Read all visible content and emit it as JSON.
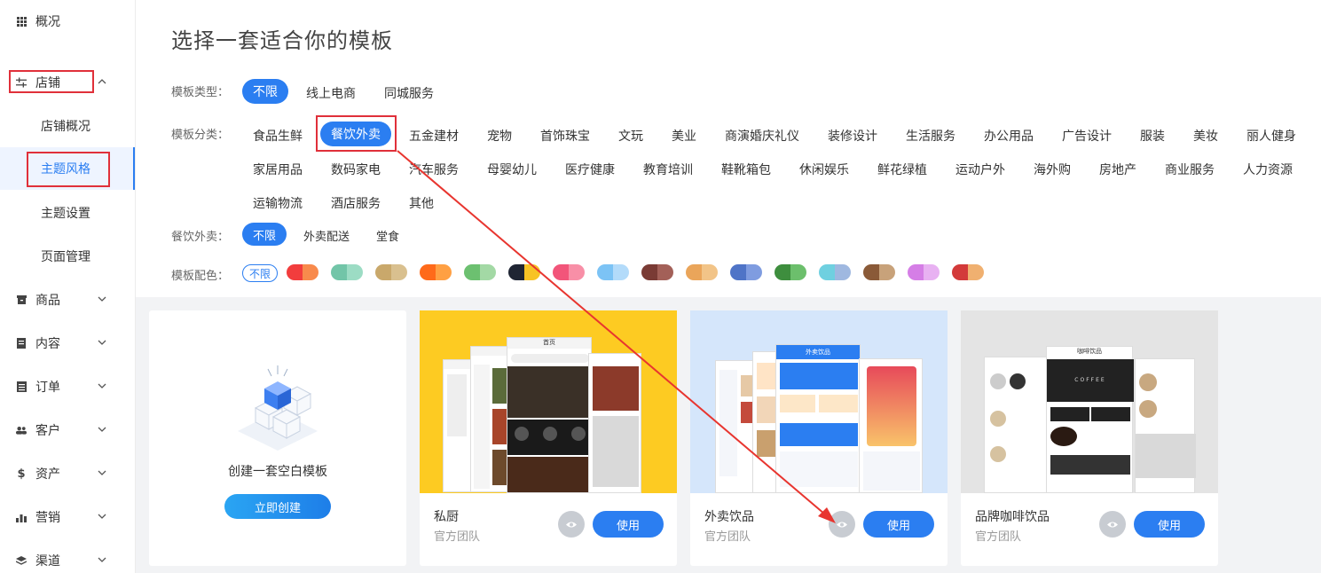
{
  "sidebar": {
    "overview": "概况",
    "store": "店铺",
    "store_children": [
      "店铺概况",
      "主题风格",
      "主题设置",
      "页面管理"
    ],
    "items": [
      "商品",
      "内容",
      "订单",
      "客户",
      "资产",
      "营销",
      "渠道"
    ]
  },
  "main": {
    "title": "选择一套适合你的模板",
    "type_label": "模板类型：",
    "type_options": [
      "不限",
      "线上电商",
      "同城服务"
    ],
    "category_label": "模板分类：",
    "categories_row1": [
      "食品生鲜",
      "餐饮外卖",
      "五金建材",
      "宠物",
      "首饰珠宝",
      "文玩",
      "美业",
      "商演婚庆礼仪",
      "装修设计",
      "生活服务",
      "办公用品",
      "广告设计",
      "服装",
      "美妆",
      "丽人健身"
    ],
    "categories_row2": [
      "家居用品",
      "数码家电",
      "汽车服务",
      "母婴幼儿",
      "医疗健康",
      "教育培训",
      "鞋靴箱包",
      "休闲娱乐",
      "鲜花绿植",
      "运动户外",
      "海外购",
      "房地产",
      "商业服务",
      "人力资源"
    ],
    "categories_row3": [
      "运输物流",
      "酒店服务",
      "其他"
    ],
    "food_label": "餐饮外卖：",
    "food_options": [
      "不限",
      "外卖配送",
      "堂食"
    ],
    "color_label": "模板配色：",
    "color_none": "不限",
    "colors": [
      [
        "#f23d3d",
        "#f88a4c"
      ],
      [
        "#72c5a8",
        "#9cdcc4"
      ],
      [
        "#c9a86b",
        "#d9c08f"
      ],
      [
        "#ff6a1a",
        "#ffa043"
      ],
      [
        "#6cc070",
        "#a3d9a5"
      ],
      [
        "#1f2533",
        "#f7c325"
      ],
      [
        "#f2557a",
        "#f88fa7"
      ],
      [
        "#7cc3f5",
        "#b3dbfa"
      ],
      [
        "#7a3b35",
        "#a36058"
      ],
      [
        "#eaa55a",
        "#f2c488"
      ],
      [
        "#4f74c7",
        "#7f9ce0"
      ],
      [
        "#3e8e3e",
        "#6cbf6c"
      ],
      [
        "#6fd0e0",
        "#9fb8e0"
      ],
      [
        "#8a5a38",
        "#c8a27a"
      ],
      [
        "#d57ee6",
        "#e8b1f2"
      ],
      [
        "#d33a3a",
        "#f0b070"
      ]
    ]
  },
  "cards": {
    "blank_title": "创建一套空白模板",
    "blank_button": "立即创建",
    "templates": [
      {
        "name": "私厨",
        "team": "官方团队",
        "use": "使用"
      },
      {
        "name": "外卖饮品",
        "team": "官方团队",
        "use": "使用"
      },
      {
        "name": "品牌咖啡饮品",
        "team": "官方团队",
        "use": "使用"
      }
    ]
  },
  "mock": {
    "home": "首页",
    "takeout": "外卖饮品",
    "coffee_title": "咖啡饮品",
    "coffee_word": "COFFEE"
  }
}
